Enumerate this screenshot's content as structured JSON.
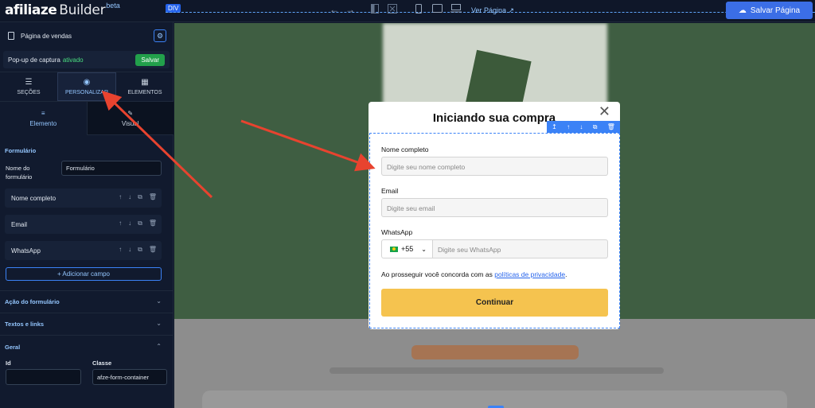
{
  "app": {
    "logo_main": "afiliaze",
    "logo_secondary": "Builder",
    "logo_badge": "beta"
  },
  "toolbar": {
    "div_tag": "DIV",
    "view_page": "Ver Página",
    "save_page": "Salvar Página"
  },
  "sidebar": {
    "page_selector": "Página de vendas",
    "popup_text": "Pop-up de captura",
    "popup_status": "ativado",
    "popup_save": "Salvar",
    "tabs": [
      {
        "label": "SEÇÕES"
      },
      {
        "label": "PERSONALIZAR"
      },
      {
        "label": "ELEMENTOS"
      }
    ],
    "subtabs": [
      {
        "label": "Elemento"
      },
      {
        "label": "Visual"
      }
    ],
    "form_section": "Formulário",
    "form_name_label": "Nome do formulário",
    "form_name_value": "Formulário",
    "fields": [
      {
        "label": "Nome completo"
      },
      {
        "label": "Email"
      },
      {
        "label": "WhatsApp"
      }
    ],
    "add_field": "+ Adicionar campo",
    "collapsibles": [
      {
        "label": "Ação do formulário"
      },
      {
        "label": "Textos e links"
      },
      {
        "label": "Geral"
      }
    ],
    "id_label": "Id",
    "id_value": "",
    "class_label": "Classe",
    "class_value": "afze-form-container"
  },
  "modal": {
    "title": "Iniciando sua compra",
    "name_label": "Nome completo",
    "name_placeholder": "Digite seu nome completo",
    "email_label": "Email",
    "email_placeholder": "Digite seu email",
    "whatsapp_label": "WhatsApp",
    "country_code": "+55",
    "whatsapp_placeholder": "Digite seu WhatsApp",
    "terms_prefix": "Ao prosseguir você concorda com as",
    "terms_link": "políticas de privacidade",
    "terms_suffix": ".",
    "submit": "Continuar"
  },
  "colors": {
    "accent": "#3b6ee6",
    "save_green": "#22a04b",
    "submit_yellow": "#f5c34f",
    "annotation_red": "#e8432f"
  }
}
